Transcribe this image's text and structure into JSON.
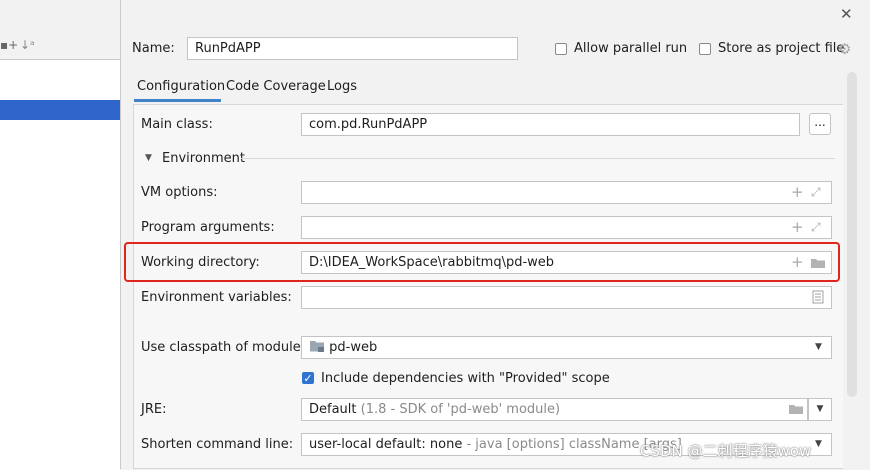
{
  "window": {
    "close_label": "✕"
  },
  "name_row": {
    "label": "Name:",
    "value": "RunPdAPP",
    "allow_parallel": "Allow parallel run",
    "store_as_project": "Store as project file"
  },
  "tabs": [
    {
      "label": "Configuration"
    },
    {
      "label": "Code Coverage"
    },
    {
      "label": "Logs"
    }
  ],
  "main_class": {
    "label": "Main class:",
    "value": "com.pd.RunPdAPP",
    "browse": "..."
  },
  "environment_section": {
    "label": "Environment"
  },
  "vm_options": {
    "label": "VM options:",
    "value": ""
  },
  "program_arguments": {
    "label": "Program arguments:",
    "value": ""
  },
  "working_directory": {
    "label": "Working directory:",
    "value": "D:\\IDEA_WorkSpace\\rabbitmq\\pd-web"
  },
  "environment_variables": {
    "label": "Environment variables:",
    "value": ""
  },
  "classpath_module": {
    "label": "Use classpath of module:",
    "value": "pd-web"
  },
  "include_provided": {
    "label": "Include dependencies with \"Provided\" scope",
    "checked": true
  },
  "jre": {
    "label": "JRE:",
    "value": "Default",
    "hint": "(1.8 - SDK of 'pd-web' module)"
  },
  "shorten_cmd": {
    "label": "Shorten command line:",
    "value": "user-local default: none",
    "hint": "- java [options] className [args]"
  },
  "watermark": "CSDN @二刺程序猿wow",
  "colors": {
    "selection": "#2f65ca",
    "highlight_border": "#e0251b",
    "accent": "#4083c9"
  }
}
